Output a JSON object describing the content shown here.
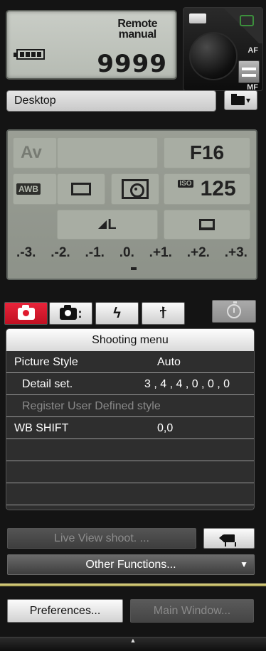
{
  "status_lcd": {
    "mode_line1": "Remote",
    "mode_line2": "manual",
    "shots_remaining": "9999"
  },
  "shutter": {
    "af_label": "AF",
    "mf_label": "MF"
  },
  "destination": {
    "folder": "Desktop",
    "folder_menu_arrow": "▾"
  },
  "settings_lcd": {
    "shooting_mode": "Av",
    "aperture": "F16",
    "white_balance": "AWB",
    "iso_label": "ISO",
    "iso": "125",
    "quality": "L",
    "exposure_scale": [
      ".-3.",
      ".-2.",
      ".-1.",
      ".0.",
      ".+1.",
      ".+2.",
      ".+3."
    ]
  },
  "tabs": {
    "tab3_symbol": "ϟ",
    "tab4_symbol": "ϯ"
  },
  "menu": {
    "header": "Shooting menu",
    "rows": [
      {
        "label": "Picture Style",
        "value": "Auto"
      },
      {
        "label": "Detail set.",
        "value": "3 , 4 , 4 , 0 , 0 , 0"
      },
      {
        "label": "Register User Defined style",
        "value": ""
      },
      {
        "label": "WB SHIFT",
        "value": "0,0"
      },
      {
        "label": "",
        "value": ""
      },
      {
        "label": "",
        "value": ""
      },
      {
        "label": "",
        "value": ""
      }
    ]
  },
  "buttons": {
    "live_view": "Live View shoot. ...",
    "other_functions": "Other Functions...",
    "other_arrow": "▼",
    "preferences": "Preferences...",
    "main_window": "Main Window..."
  },
  "footer": {
    "collapse_arrow": "▲"
  },
  "colors": {
    "active_tab": "#e01a2e",
    "lcd": "#9a9e95",
    "accent_line": "#d9cf7a"
  }
}
